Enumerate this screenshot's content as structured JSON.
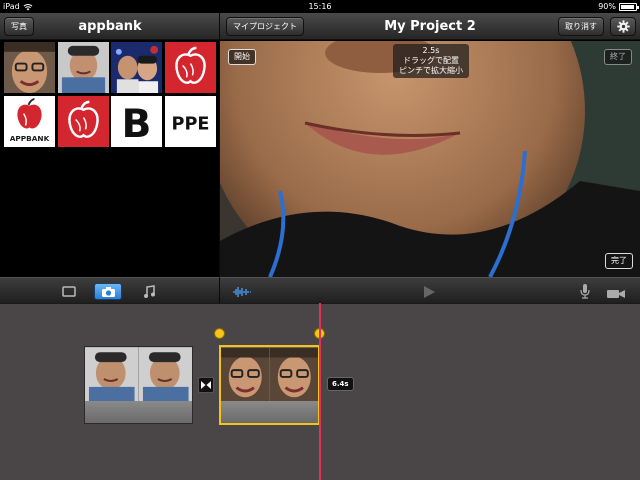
{
  "status_bar": {
    "device": "iPad",
    "time": "15:16",
    "battery": "90%",
    "battery_level": 0.9
  },
  "library": {
    "back_button": "写真",
    "album_title": "appbank",
    "thumbnails": [
      "face-photo",
      "face-photo",
      "couple-photo",
      "apple-logo-red",
      "appbank-logo",
      "apple-logo-red",
      "text-b",
      "text-ppe"
    ],
    "text_thumbs": {
      "b": "B",
      "ppe": "PPE"
    },
    "logo_text": "APPBANK"
  },
  "project": {
    "my_projects_button": "マイプロジェクト",
    "title": "My Project 2",
    "undo_button": "取り消す"
  },
  "viewer": {
    "start_button": "開始",
    "end_button": "終了",
    "done_button": "完了",
    "hint": {
      "duration": "2.5s",
      "line1": "ドラッグで配置",
      "line2": "ピンチで拡大縮小"
    }
  },
  "toolbar": {
    "left": [
      "video-icon",
      "camera-icon",
      "music-note-icon"
    ],
    "active_left": "camera-icon",
    "right": [
      "audio-waveform-icon",
      "play-icon",
      "microphone-icon",
      "video-camera-icon"
    ]
  },
  "timeline": {
    "selected_clip_duration": "6.4s"
  },
  "colors": {
    "accent_blue": "#2a7fd4",
    "selection_yellow": "#f3c21b",
    "playhead": "#e0305a"
  }
}
